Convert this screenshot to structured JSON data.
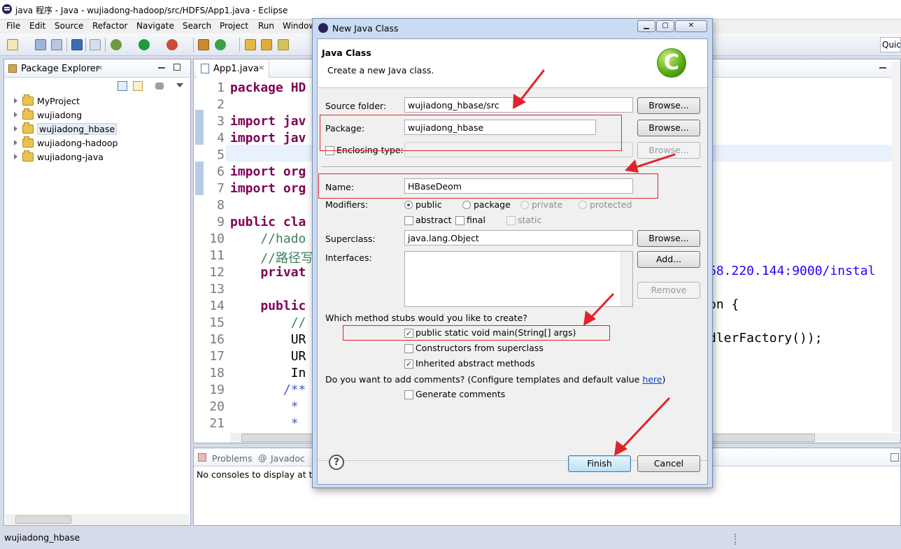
{
  "window": {
    "title": "java 程序 - Java - wujiadong-hadoop/src/HDFS/App1.java - Eclipse"
  },
  "menu": [
    "File",
    "Edit",
    "Source",
    "Refactor",
    "Navigate",
    "Search",
    "Project",
    "Run",
    "Window"
  ],
  "toolbar": {
    "quick_access": "Quick"
  },
  "package_explorer": {
    "title": "Package Explorer",
    "close": "×",
    "projects": [
      "MyProject",
      "wujiadong",
      "wujiadong_hbase",
      "wujiadong-hadoop",
      "wujiadong-java"
    ],
    "selected": "wujiadong_hbase"
  },
  "editor": {
    "tab": "App1.java",
    "close": "×",
    "lines": [
      {
        "n": "1",
        "t": "package HD"
      },
      {
        "n": "2",
        "t": ""
      },
      {
        "n": "3",
        "t": "import jav"
      },
      {
        "n": "4",
        "t": "import jav"
      },
      {
        "n": "5",
        "t": ""
      },
      {
        "n": "6",
        "t": "import org"
      },
      {
        "n": "7",
        "t": "import org"
      },
      {
        "n": "8",
        "t": ""
      },
      {
        "n": "9",
        "t": "public cla"
      },
      {
        "n": "10",
        "t": "    //hado"
      },
      {
        "n": "11",
        "t": "    //路径写"
      },
      {
        "n": "12",
        "t": "    privat"
      },
      {
        "n": "13",
        "t": ""
      },
      {
        "n": "14",
        "t": "    public"
      },
      {
        "n": "15",
        "t": "        //"
      },
      {
        "n": "16",
        "t": "        UR"
      },
      {
        "n": "17",
        "t": "        UR"
      },
      {
        "n": "18",
        "t": "        In"
      },
      {
        "n": "19",
        "t": "       /**"
      },
      {
        "n": "20",
        "t": "        *"
      },
      {
        "n": "21",
        "t": "        *"
      }
    ],
    "right_fragments": {
      "line12": "68.220.144:9000/instal",
      "line14": "on {",
      "line16": "dlerFactory());"
    }
  },
  "console": {
    "tabs": [
      "Problems",
      "Javadoc"
    ],
    "message": "No consoles to display at thi"
  },
  "status": {
    "text": "wujiadong_hbase"
  },
  "dialog": {
    "title": "New Java Class",
    "header_title": "Java Class",
    "header_desc": "Create a new Java class.",
    "icon_letter": "C",
    "source_folder": {
      "label": "Source folder:",
      "value": "wujiadong_hbase/src",
      "browse": "Browse..."
    },
    "package": {
      "label": "Package:",
      "value": "wujiadong_hbase",
      "browse": "Browse..."
    },
    "enclosing": {
      "label": "Enclosing type:",
      "value": "",
      "browse": "Browse..."
    },
    "name": {
      "label": "Name:",
      "value": "HBaseDeom"
    },
    "modifiers": {
      "label": "Modifiers:",
      "public": "public",
      "package": "package",
      "private": "private",
      "protected": "protected",
      "abstract": "abstract",
      "final": "final",
      "static": "static"
    },
    "superclass": {
      "label": "Superclass:",
      "value": "java.lang.Object",
      "browse": "Browse..."
    },
    "interfaces": {
      "label": "Interfaces:",
      "add": "Add...",
      "remove": "Remove"
    },
    "stubs": {
      "question": "Which method stubs would you like to create?",
      "main": "public static void main(String[] args)",
      "constructors": "Constructors from superclass",
      "inherited": "Inherited abstract methods"
    },
    "comments": {
      "question_prefix": "Do you want to add comments? (Configure templates and default value ",
      "link": "here",
      "question_suffix": ")",
      "generate": "Generate comments"
    },
    "finish": "Finish",
    "cancel": "Cancel",
    "help": "?",
    "check": "✓"
  },
  "colors": {
    "annotation": "#e0232a",
    "dialog_frame": "#c9dcf3"
  }
}
